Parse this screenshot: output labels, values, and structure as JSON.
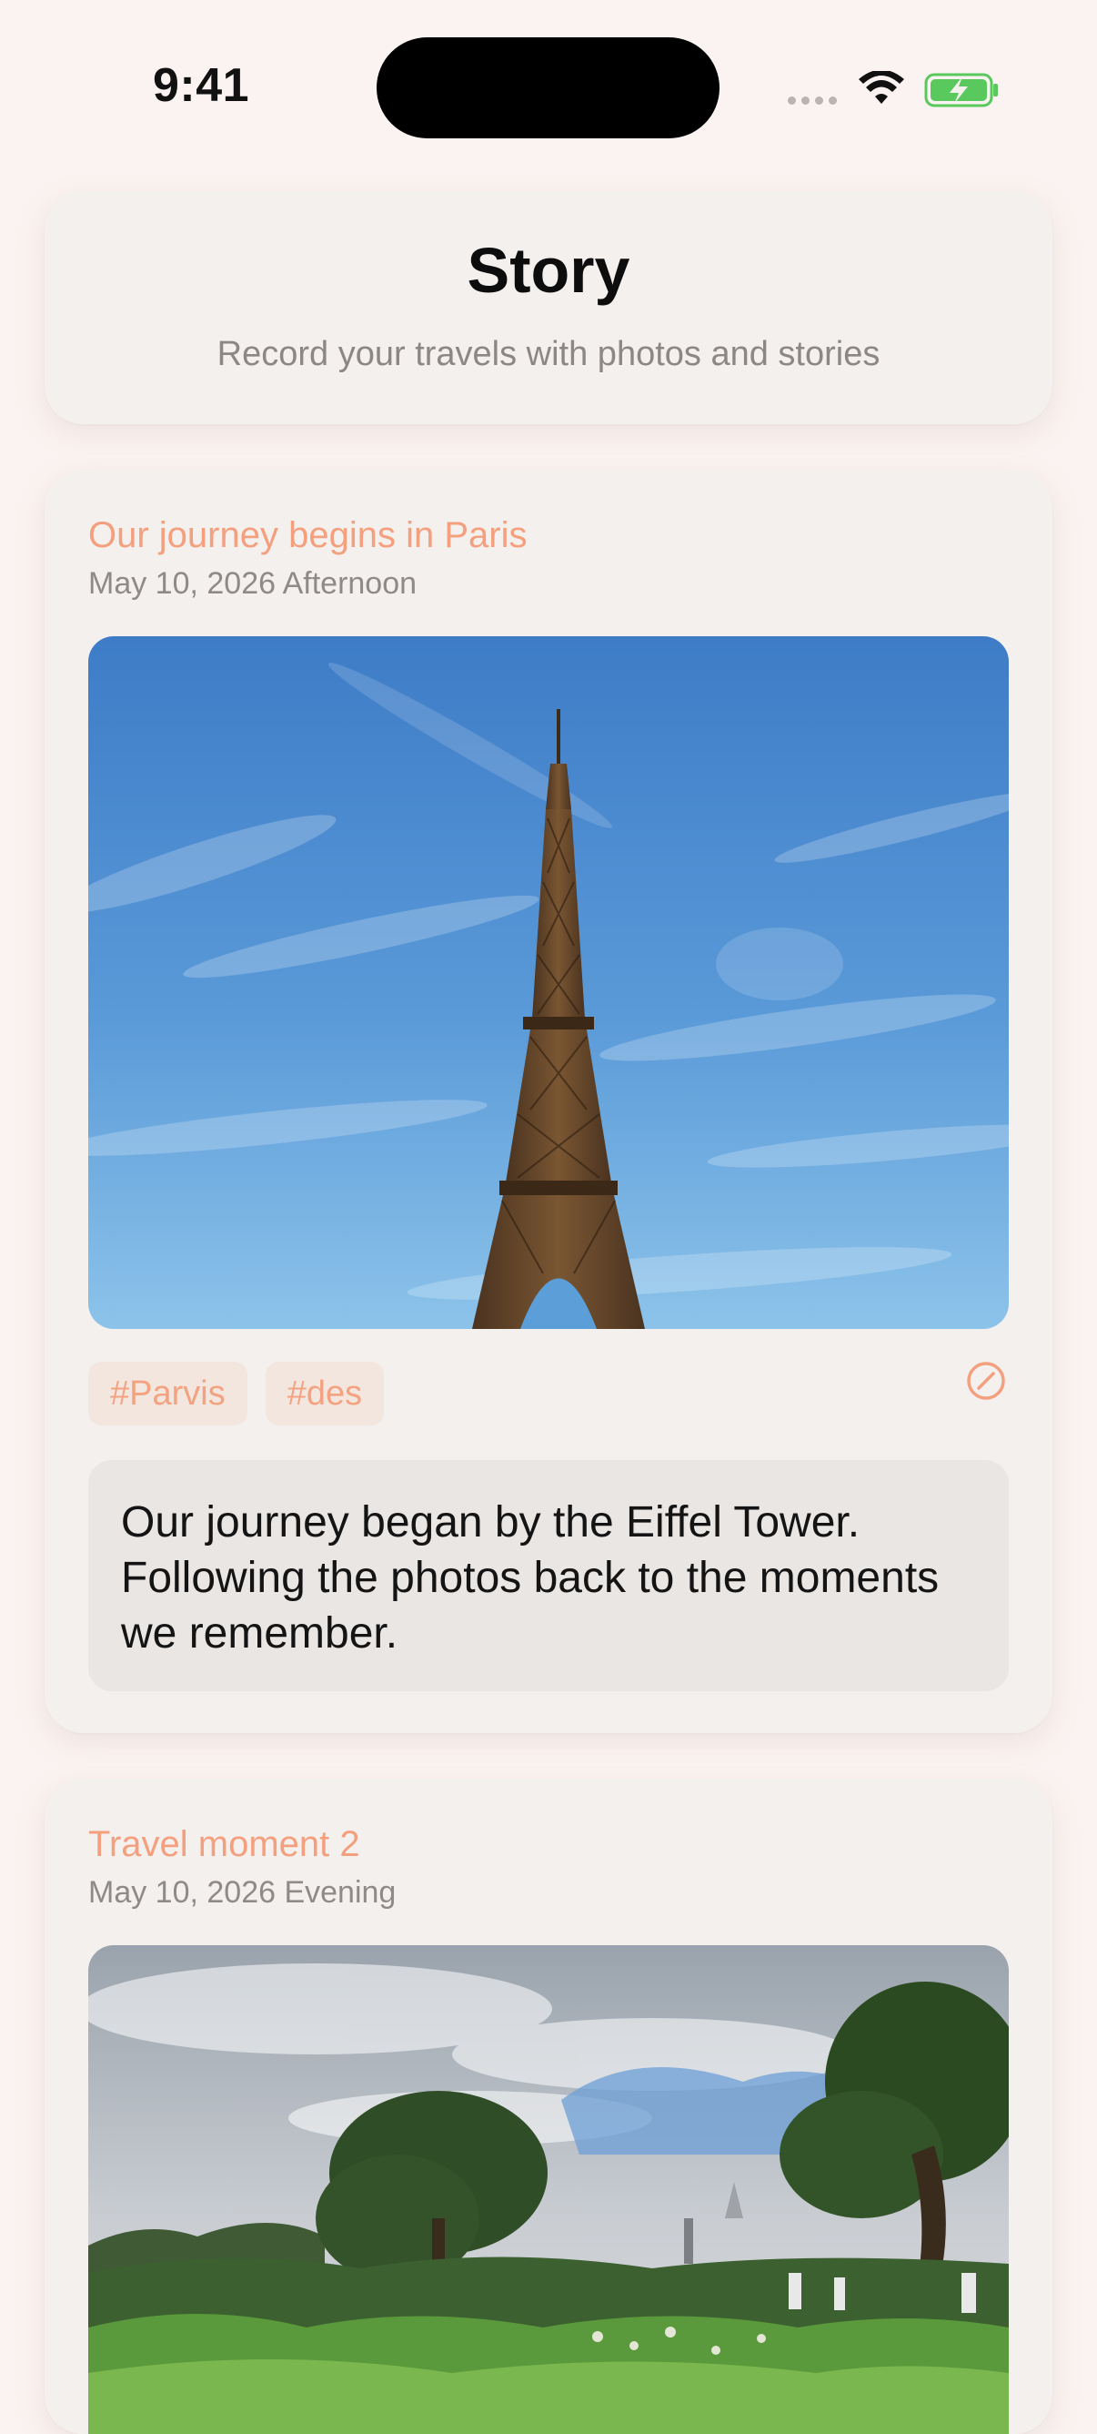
{
  "status_bar": {
    "time": "9:41"
  },
  "header": {
    "title": "Story",
    "subtitle": "Record your travels with photos and stories"
  },
  "stories": [
    {
      "title": "Our journey begins in Paris",
      "date": "May 10, 2026 Afternoon",
      "tags": [
        "#Parvis",
        "#des"
      ],
      "text": "Our journey began by the Eiffel Tower. Following the photos back to the moments we remember."
    },
    {
      "title": "Travel moment 2",
      "date": "May 10, 2026 Evening"
    }
  ],
  "icons": {
    "edit": "edit-icon",
    "wifi": "wifi-icon",
    "battery": "battery-charging-icon"
  },
  "colors": {
    "accent": "#f4a07f",
    "background": "#fbf3f1",
    "card": "#f4f0ee",
    "battery": "#59c85d"
  }
}
